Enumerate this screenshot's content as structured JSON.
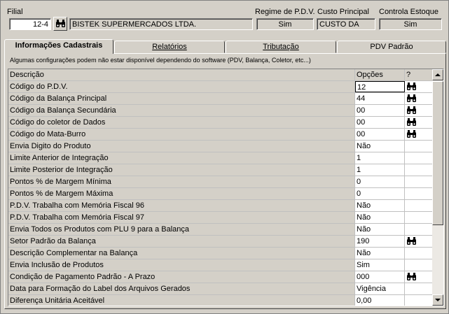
{
  "header": {
    "filial_label": "Filial",
    "filial_code": "12-4",
    "filial_name": "BISTEK SUPERMERCADOS LTDA.",
    "regime_label": "Regime de P.D.V.",
    "regime_value": "Sim",
    "custo_label": "Custo Principal",
    "custo_value": "CUSTO DA",
    "controla_label": "Controla Estoque",
    "controla_value": "Sim"
  },
  "tabs": [
    {
      "label": "Informações Cadastrais"
    },
    {
      "label": "Relatórios"
    },
    {
      "label": "Tributação"
    },
    {
      "label": "PDV Padrão"
    }
  ],
  "note": "Algumas configurações podem não estar disponível dependendo do software (PDV, Balança, Coletor, etc...)",
  "grid": {
    "columns": [
      "Descrição",
      "Opções",
      "?"
    ],
    "rows": [
      {
        "desc": "Código do P.D.V.",
        "value": "12",
        "lookup": true
      },
      {
        "desc": "Código da Balança Principal",
        "value": "44",
        "lookup": true
      },
      {
        "desc": "Código da Balança Secundária",
        "value": "00",
        "lookup": true
      },
      {
        "desc": "Código do coletor de Dados",
        "value": "00",
        "lookup": true
      },
      {
        "desc": "Código do Mata-Burro",
        "value": "00",
        "lookup": true
      },
      {
        "desc": "Envia Digito do Produto",
        "value": "Não",
        "lookup": false
      },
      {
        "desc": "Limite Anterior de Integração",
        "value": "1",
        "lookup": false
      },
      {
        "desc": "Limite Posterior de Integração",
        "value": "1",
        "lookup": false
      },
      {
        "desc": "Pontos % de Margem Mínima",
        "value": "0",
        "lookup": false
      },
      {
        "desc": "Pontos % de Margem Máxima",
        "value": "0",
        "lookup": false
      },
      {
        "desc": "P.D.V. Trabalha com Memória Fiscal 96",
        "value": "Não",
        "lookup": false
      },
      {
        "desc": "P.D.V. Trabalha com Memória Fiscal 97",
        "value": "Não",
        "lookup": false
      },
      {
        "desc": "Envia Todos os Produtos com PLU 9 para a Balança",
        "value": "Não",
        "lookup": false
      },
      {
        "desc": "Setor Padrão da Balança",
        "value": "190",
        "lookup": true
      },
      {
        "desc": "Descrição Complementar na Balança",
        "value": "Não",
        "lookup": false
      },
      {
        "desc": "Envia Inclusão de Produtos",
        "value": "Sim",
        "lookup": false
      },
      {
        "desc": "Condição de Pagamento Padrão - A Prazo",
        "value": "000",
        "lookup": true
      },
      {
        "desc": "Data para Formação do Label dos Arquivos Gerados",
        "value": "Vigência",
        "lookup": false
      },
      {
        "desc": "Diferença Unitária Aceitável",
        "value": "0,00",
        "lookup": false
      }
    ]
  },
  "icons": {
    "lookup": "binoculars-icon",
    "scroll_up": "scroll-up-arrow-icon",
    "scroll_down": "scroll-down-arrow-icon"
  }
}
